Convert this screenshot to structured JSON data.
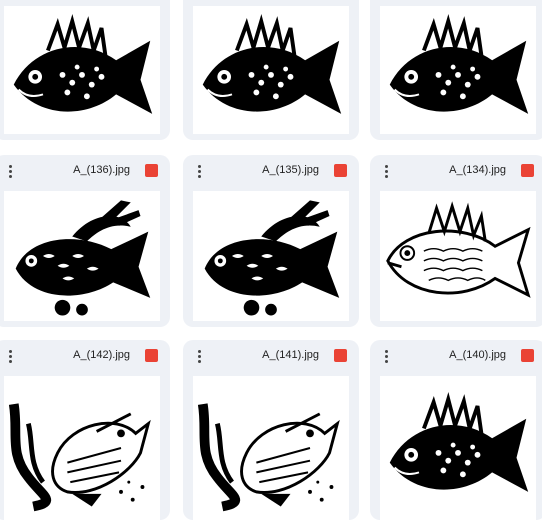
{
  "files": [
    {
      "name": "",
      "type_icon": "image-file-icon"
    },
    {
      "name": "",
      "type_icon": "image-file-icon"
    },
    {
      "name": "",
      "type_icon": "image-file-icon"
    },
    {
      "name": "A_(136).jpg",
      "type_icon": "image-file-icon"
    },
    {
      "name": "A_(135).jpg",
      "type_icon": "image-file-icon"
    },
    {
      "name": "A_(134).jpg",
      "type_icon": "image-file-icon"
    },
    {
      "name": "A_(142).jpg",
      "type_icon": "image-file-icon"
    },
    {
      "name": "A_(141).jpg",
      "type_icon": "image-file-icon"
    },
    {
      "name": "A_(140).jpg",
      "type_icon": "image-file-icon"
    }
  ],
  "colors": {
    "card_bg": "#eef1f6",
    "file_icon": "#ea4335",
    "ink": "#000000"
  }
}
